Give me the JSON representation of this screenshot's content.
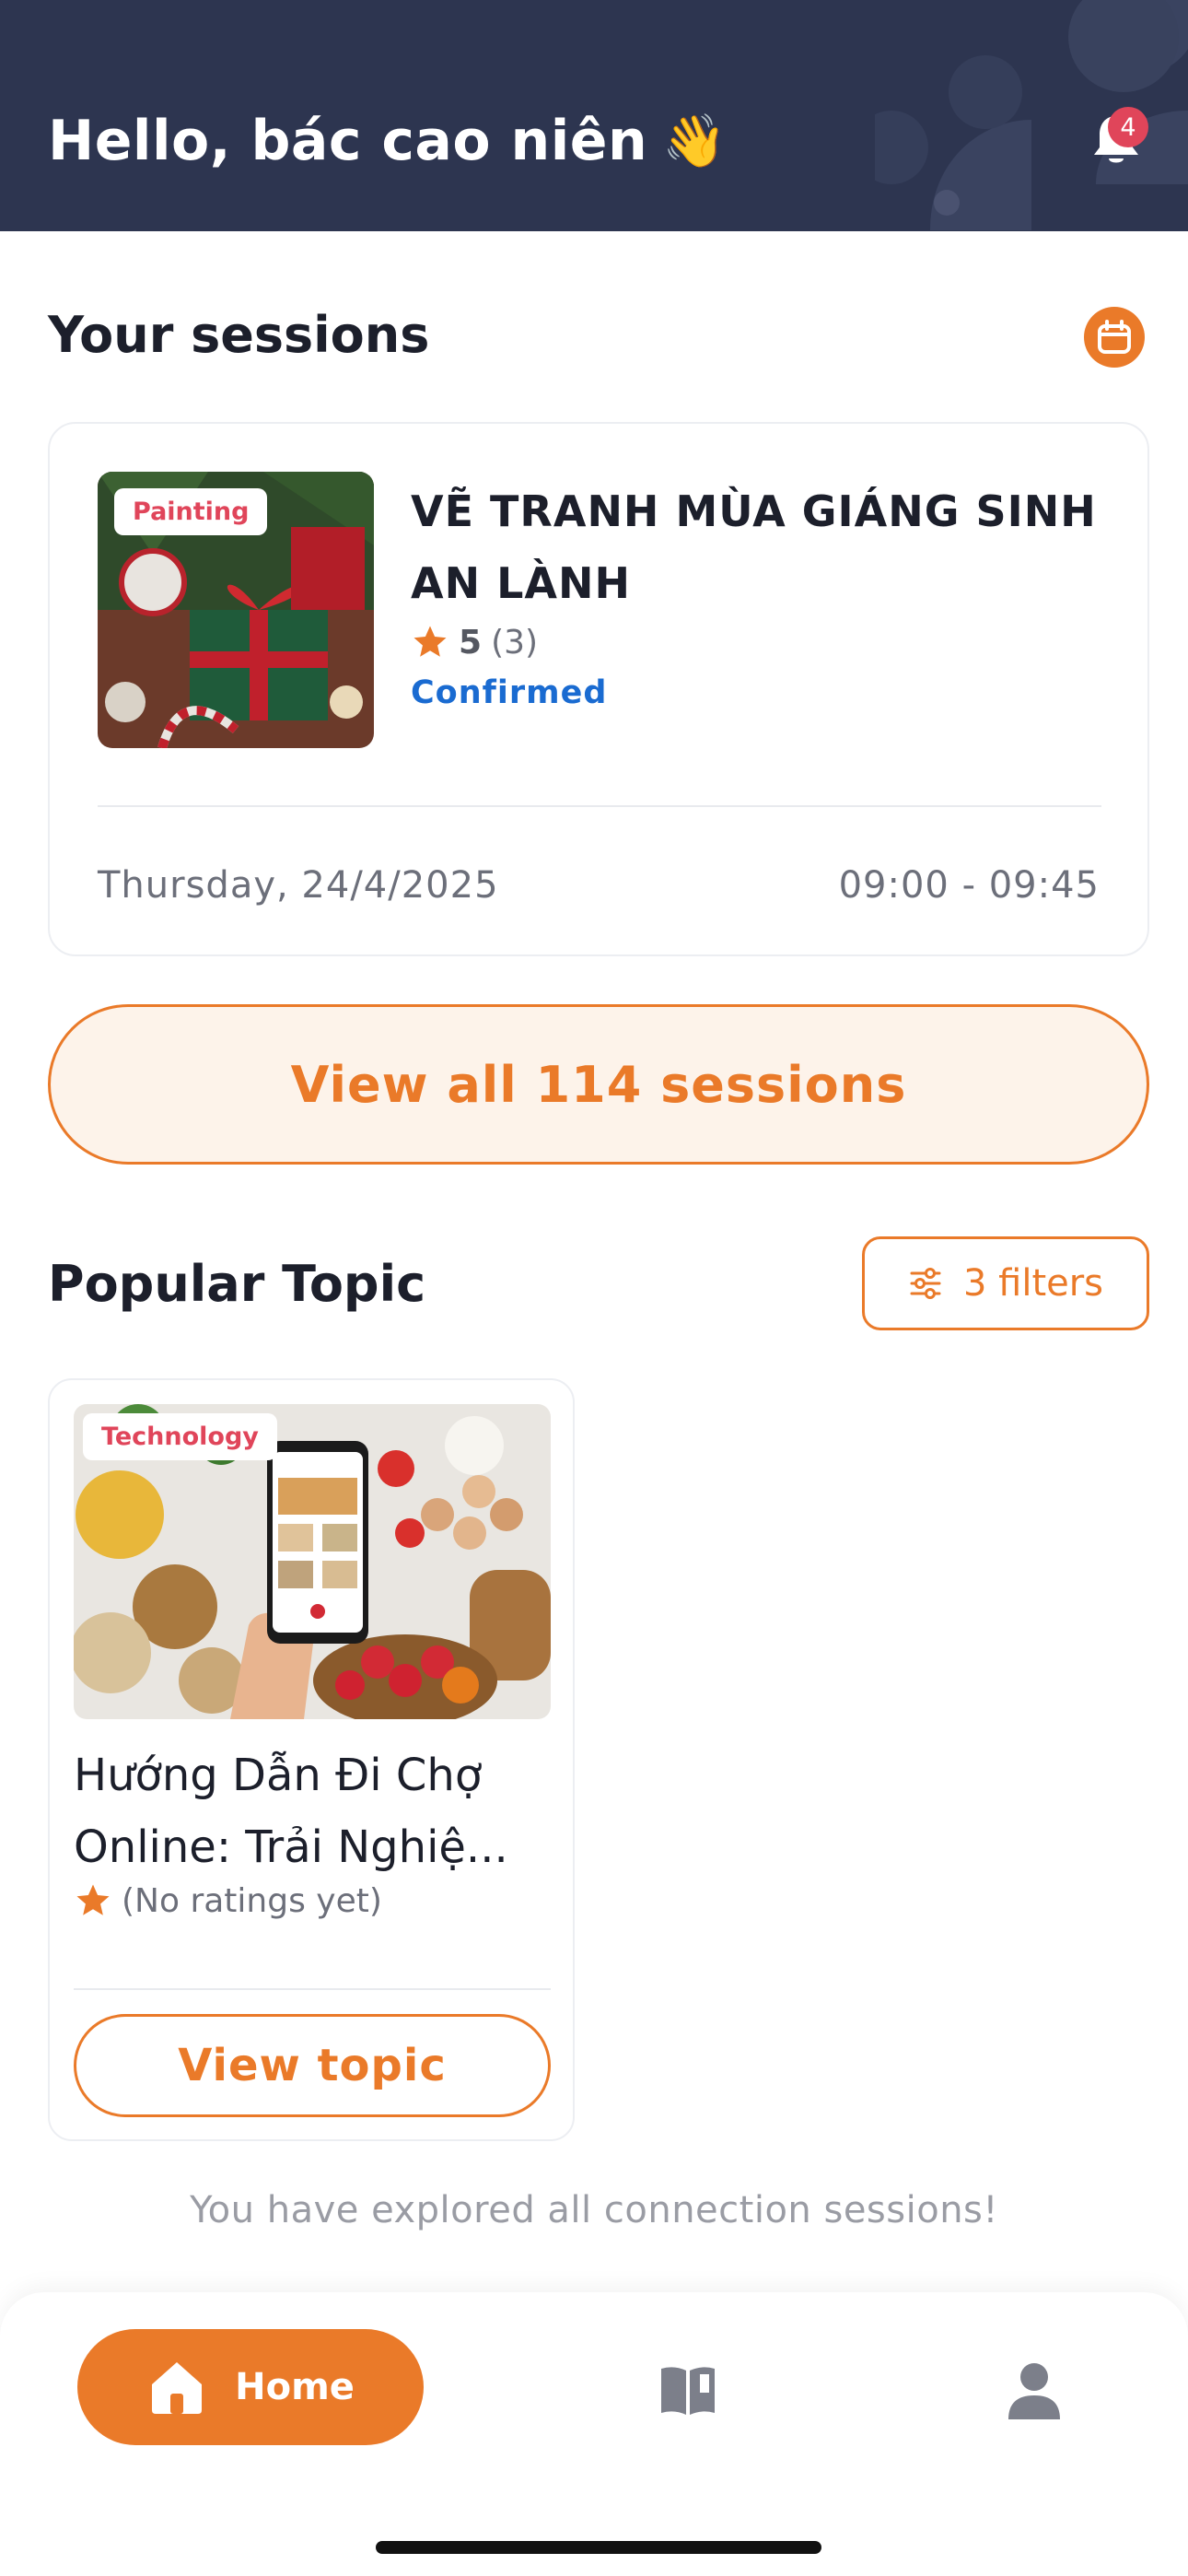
{
  "header": {
    "greeting": "Hello, bác cao niên",
    "greeting_emoji": "👋",
    "notification_count": "4",
    "background_color": "#2d3550"
  },
  "sessions": {
    "title": "Your sessions",
    "calendar_icon": "calendar-icon",
    "card": {
      "category_tag": "Painting",
      "title": "VẼ TRANH MÙA GIÁNG SINH AN LÀNH",
      "rating_score": "5",
      "rating_count": "(3)",
      "status": "Confirmed",
      "date": "Thursday, 24/4/2025",
      "time": "09:00 - 09:45"
    },
    "view_all_label": "View all 114 sessions"
  },
  "popular": {
    "title": "Popular Topic",
    "filter_label": "3 filters",
    "topics": [
      {
        "category_tag": "Technology",
        "title": "Hướng Dẫn Đi Chợ Online: Trải Nghiệ...",
        "rating_text": "(No ratings yet)",
        "button_label": "View topic"
      }
    ],
    "end_message": "You have explored all connection sessions!"
  },
  "nav": {
    "home_label": "Home",
    "items": [
      "home-icon",
      "book-icon",
      "profile-icon"
    ]
  },
  "colors": {
    "accent": "#ea7a29",
    "status_blue": "#1a6bd1",
    "tag_red": "#e0455a"
  }
}
